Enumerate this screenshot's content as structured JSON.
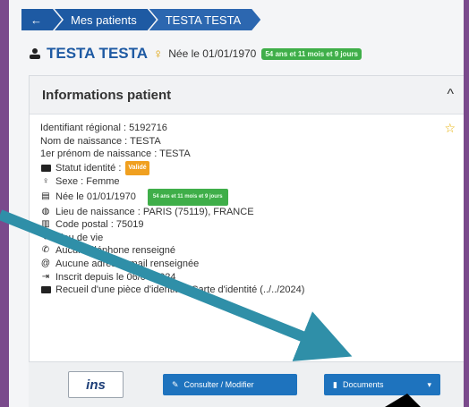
{
  "breadcrumb": {
    "items": [
      "←",
      "Mes patients",
      "TESTA TESTA"
    ]
  },
  "patient": {
    "name": "TESTA TESTA",
    "birth_text": "Née le 01/01/1970",
    "age_badge": "54 ans et 11 mois et 9 jours"
  },
  "card": {
    "title": "Informations patient",
    "fields": [
      {
        "icon": "",
        "text": "Identifiant régional : 5192716"
      },
      {
        "icon": "",
        "text": "Nom de naissance : TESTA"
      },
      {
        "icon": "",
        "text": "1er prénom de naissance : TESTA"
      },
      {
        "icon": "id-card-icon",
        "text": "Statut identité :",
        "badge": "Validé"
      },
      {
        "icon": "venus-icon",
        "text": "Sexe : Femme"
      },
      {
        "icon": "calendar-icon",
        "text": "Née le 01/01/1970",
        "age_badge": "54 ans et 11 mois et 9 jours"
      },
      {
        "icon": "globe-icon",
        "text": "Lieu de naissance : PARIS (75119), FRANCE"
      },
      {
        "icon": "building-icon",
        "text": "Code postal : 75019"
      },
      {
        "icon": "map-pin-icon",
        "text": "Lieu de vie"
      },
      {
        "icon": "phone-icon",
        "text": "Aucun téléphone renseigné"
      },
      {
        "icon": "at-icon",
        "text": "Aucune adresse mail renseignée"
      },
      {
        "icon": "sign-in-icon",
        "text": "Inscrit depuis le 06/06/2024"
      },
      {
        "icon": "id-card-icon",
        "text": "Recueil d'une pièce d'identité : Carte d'identité (../../2024)"
      }
    ]
  },
  "footer": {
    "ins_label": "ins",
    "consult_label": "Consulter / Modifier",
    "documents_label": "Documents",
    "dropdown_caret": "▾"
  },
  "colors": {
    "primary": "#1e5aa3",
    "button": "#1e73be",
    "success": "#3fae49",
    "warning": "#f0a020",
    "arrow": "#2f8fa8"
  }
}
